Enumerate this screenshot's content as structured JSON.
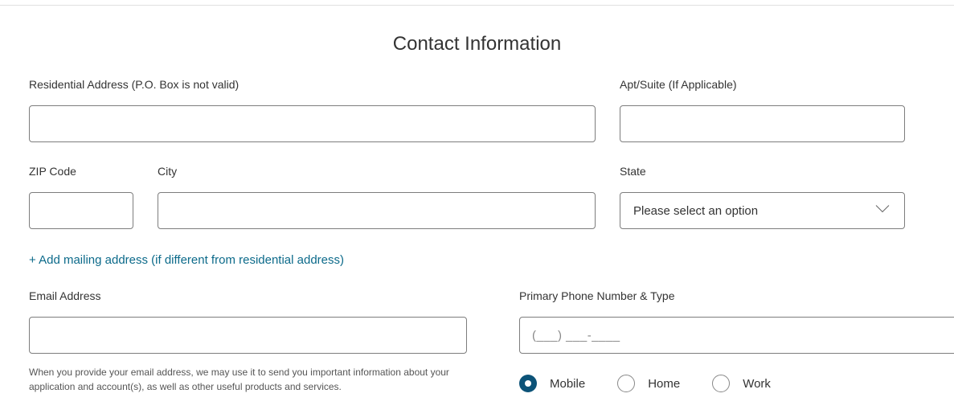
{
  "heading": "Contact Information",
  "fields": {
    "address": {
      "label": "Residential Address (P.O. Box is not valid)",
      "value": ""
    },
    "apt": {
      "label": "Apt/Suite (If Applicable)",
      "value": ""
    },
    "zip": {
      "label": "ZIP Code",
      "value": ""
    },
    "city": {
      "label": "City",
      "value": ""
    },
    "state": {
      "label": "State",
      "placeholder": "Please select an option",
      "value": ""
    },
    "email": {
      "label": "Email Address",
      "value": ""
    },
    "phone": {
      "label": "Primary Phone Number & Type",
      "mask": "(___) ___-____",
      "value": ""
    }
  },
  "mailing_link": "+ Add mailing address (if different from residential address)",
  "email_helper": "When you provide your email address, we may use it to send you important information about your application and account(s), as well as other useful products and services.",
  "phone_types": {
    "options": [
      {
        "key": "mobile",
        "label": "Mobile"
      },
      {
        "key": "home",
        "label": "Home"
      },
      {
        "key": "work",
        "label": "Work"
      }
    ],
    "selected": "mobile"
  },
  "colors": {
    "accent": "#0c5378",
    "link": "#0c6a8a"
  }
}
